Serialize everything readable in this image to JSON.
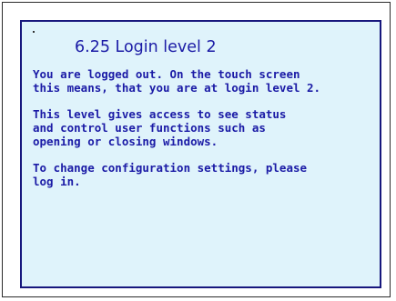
{
  "help_screen": {
    "title": "6.25 Login level 2",
    "paragraphs": [
      "You are logged out. On the touch screen\nthis means, that you are at login level 2.",
      "This level gives access to see status\nand control user functions such as\nopening or closing windows.",
      "To change configuration settings, please\nlog in."
    ]
  },
  "colors": {
    "panel_background": "#dff3fb",
    "panel_border": "#17177d",
    "text": "#1b1ba6"
  }
}
